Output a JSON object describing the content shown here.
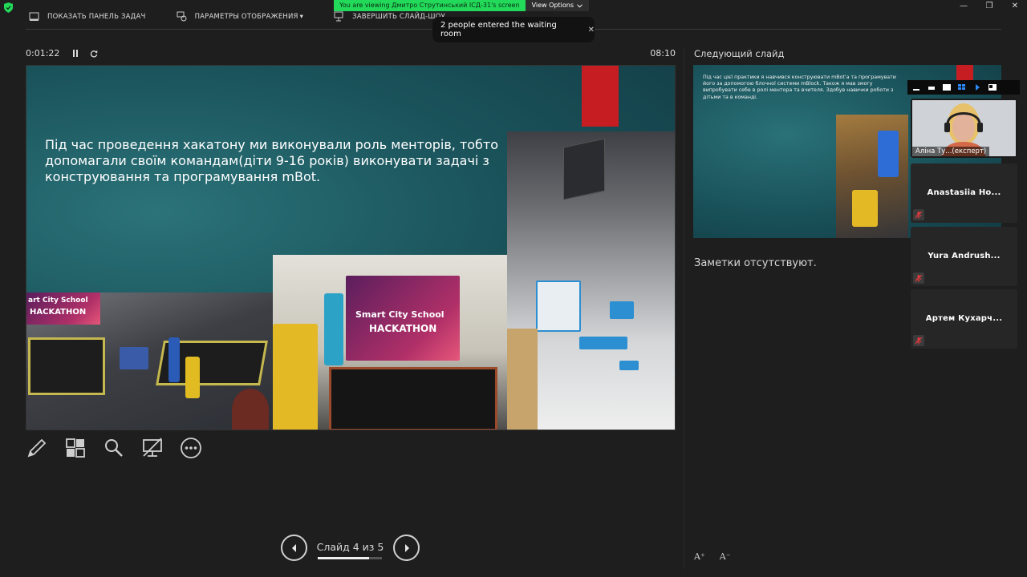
{
  "share_banner": {
    "viewing_text": "You are viewing Дмитро Струтинський ІСД-31's screen",
    "view_options": "View Options"
  },
  "toolbar": {
    "show_taskbar": "ПОКАЗАТЬ ПАНЕЛЬ ЗАДАЧ",
    "display_settings": "ПАРАМЕТРЫ ОТОБРАЖЕНИЯ",
    "end_show": "ЗАВЕРШИТЬ СЛАЙД-ШОУ"
  },
  "toast": {
    "text": "2 people entered the waiting room",
    "close_glyph": "✕"
  },
  "timer": {
    "elapsed": "0:01:22",
    "clock": "08:10"
  },
  "slide": {
    "text": "Під час проведення хакатону ми виконували роль менторів, тобто допомагали своїм командам(діти 9-16 років) виконувати задачі з конструювання та програмування mBot.",
    "banner_line1": "Smart City School",
    "banner_line2": "HACKATHON",
    "left_banner_line1": "art City School",
    "left_banner_line2": "HACKATHON"
  },
  "nav": {
    "label": "Слайд 4 из 5",
    "progress": 0.8
  },
  "next": {
    "label": "Следующий слайд",
    "text": "Під час цієї практики я навчився конструювати mBot'a та програмувати його за допомогою блочної системи mBlock. Також я мав змогу випробувати себе в ролі ментора та вчителя. Здобув навички роботи з дітьми та в команді."
  },
  "notes": "Заметки отсутствуют.",
  "participants": [
    {
      "name": "Аліна Ту...(експерт)",
      "video": true
    },
    {
      "name": "Anastasiia Ho...",
      "video": false
    },
    {
      "name": "Yura Andrush...",
      "video": false
    },
    {
      "name": "Артем Кухарч...",
      "video": false
    }
  ],
  "font_buttons": {
    "increase": "A⁺",
    "decrease": "A⁻"
  },
  "colors": {
    "accent_green": "#23d959",
    "slide_red": "#c51d22",
    "mute_red": "#e0393e"
  }
}
